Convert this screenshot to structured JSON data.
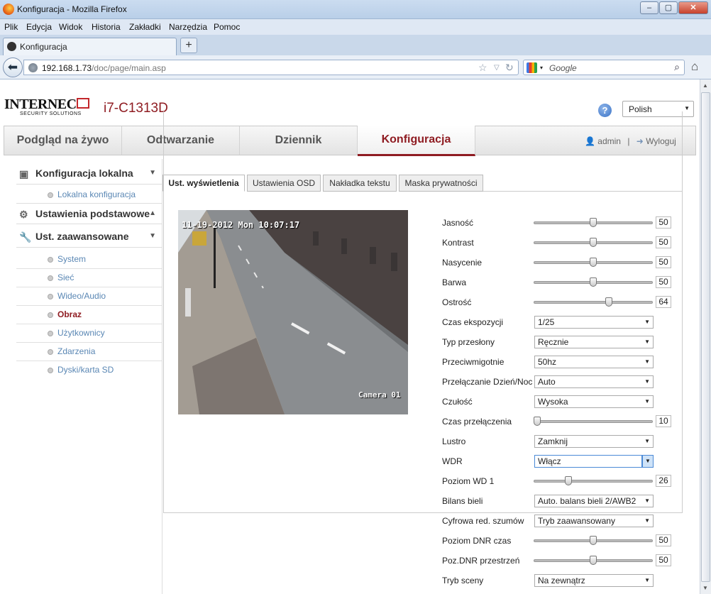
{
  "window": {
    "title": "Konfiguracja - Mozilla Firefox"
  },
  "menubar": [
    "Plik",
    "Edycja",
    "Widok",
    "Historia",
    "Zakładki",
    "Narzędzia",
    "Pomoc"
  ],
  "browser_tab": {
    "title": "Konfiguracja"
  },
  "address": {
    "host": "192.168.1.73",
    "path": "/doc/page/main.asp"
  },
  "search": {
    "placeholder": "Google"
  },
  "header": {
    "logo_text": "INTERNEC",
    "logo_sub": "SECURITY SOLUTIONS",
    "model": "i7-C1313D",
    "language": "Polish"
  },
  "main_nav": {
    "tabs": [
      "Podgląd na żywo",
      "Odtwarzanie",
      "Dziennik",
      "Konfiguracja"
    ],
    "active": "Konfiguracja"
  },
  "user": {
    "name": "admin",
    "separator": "|",
    "logout": "Wyloguj"
  },
  "sidebar": {
    "local": {
      "title": "Konfiguracja lokalna",
      "items": [
        "Lokalna konfiguracja"
      ]
    },
    "basic": {
      "title": "Ustawienia podstawowe"
    },
    "advanced": {
      "title": "Ust. zaawansowane",
      "items": [
        "System",
        "Sieć",
        "Wideo/Audio",
        "Obraz",
        "Użytkownicy",
        "Zdarzenia",
        "Dyski/karta SD"
      ],
      "active": "Obraz"
    }
  },
  "content_tabs": [
    "Ust. wyświetlenia",
    "Ustawienia OSD",
    "Nakładka tekstu",
    "Maska prywatności"
  ],
  "video": {
    "osd_time": "11-19-2012 Mon 10:07:17",
    "camera_name": "Camera 01"
  },
  "settings": [
    {
      "label": "Jasność",
      "type": "slider",
      "value": 50,
      "fraction": 0.5
    },
    {
      "label": "Kontrast",
      "type": "slider",
      "value": 50,
      "fraction": 0.5
    },
    {
      "label": "Nasycenie",
      "type": "slider",
      "value": 50,
      "fraction": 0.5
    },
    {
      "label": "Barwa",
      "type": "slider",
      "value": 50,
      "fraction": 0.5
    },
    {
      "label": "Ostrość",
      "type": "slider",
      "value": 64,
      "fraction": 0.64
    },
    {
      "label": "Czas ekspozycji",
      "type": "select",
      "value": "1/25"
    },
    {
      "label": "Typ przesłony",
      "type": "select",
      "value": "Ręcznie"
    },
    {
      "label": "Przeciwmigotnie",
      "type": "select",
      "value": "50hz"
    },
    {
      "label": "Przełączanie Dzień/Noc",
      "type": "select",
      "value": "Auto"
    },
    {
      "label": "Czułość",
      "type": "select",
      "value": "Wysoka"
    },
    {
      "label": "Czas przełączenia",
      "type": "slider",
      "value": 10,
      "fraction": 0.0
    },
    {
      "label": "Lustro",
      "type": "select",
      "value": "Zamknij"
    },
    {
      "label": "WDR",
      "type": "select",
      "value": "Włącz",
      "focused": true
    },
    {
      "label": "Poziom WD 1",
      "type": "slider",
      "value": 26,
      "fraction": 0.28
    },
    {
      "label": "Bilans bieli",
      "type": "select",
      "value": "Auto. balans bieli 2/AWB2"
    },
    {
      "label": "Cyfrowa red. szumów",
      "type": "select",
      "value": "Tryb zaawansowany"
    },
    {
      "label": "Poziom DNR czas",
      "type": "slider",
      "value": 50,
      "fraction": 0.5
    },
    {
      "label": "Poz.DNR przestrzeń",
      "type": "slider",
      "value": 50,
      "fraction": 0.5
    },
    {
      "label": "Tryb sceny",
      "type": "select",
      "value": "Na zewnątrz"
    }
  ]
}
